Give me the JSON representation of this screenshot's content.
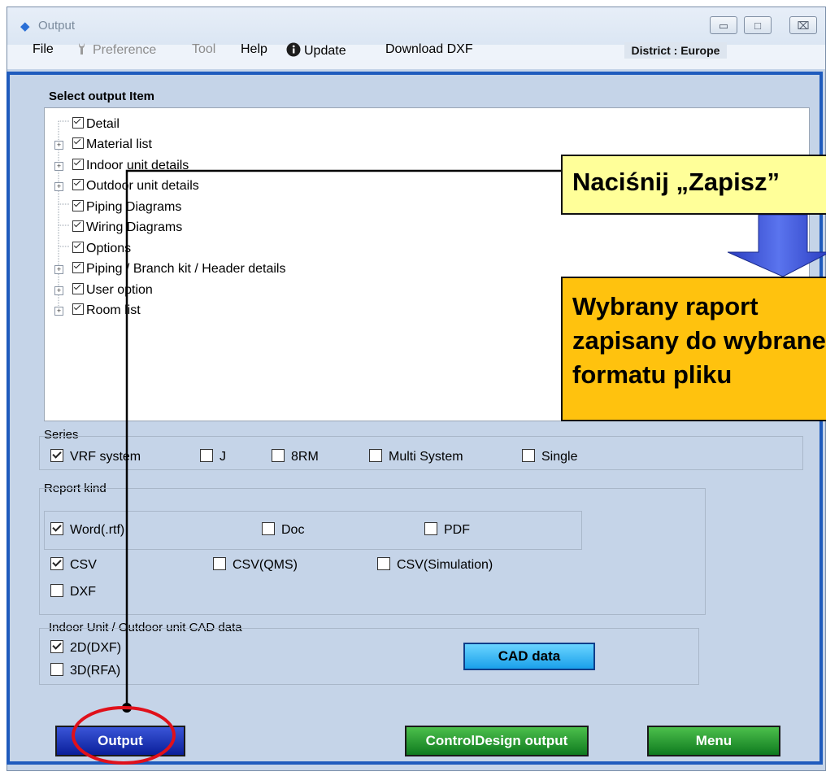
{
  "window": {
    "title": "Output",
    "minimize_glyph": "▭",
    "maximize_glyph": "□",
    "close_glyph": "⌧"
  },
  "menu": {
    "file": "File",
    "preference": "Preference",
    "tool": "Tool",
    "help": "Help",
    "update": "Update",
    "download_dxf": "Download DXF",
    "district": "District : Europe"
  },
  "select_output": {
    "label": "Select output Item",
    "items": [
      {
        "label": "Detail",
        "expandable": false,
        "checked": true
      },
      {
        "label": "Material list",
        "expandable": true,
        "checked": true
      },
      {
        "label": "Indoor unit details",
        "expandable": true,
        "checked": true
      },
      {
        "label": "Outdoor unit details",
        "expandable": true,
        "checked": true
      },
      {
        "label": "Piping Diagrams",
        "expandable": false,
        "checked": true
      },
      {
        "label": "Wiring Diagrams",
        "expandable": false,
        "checked": true
      },
      {
        "label": "Options",
        "expandable": false,
        "checked": true
      },
      {
        "label": "Piping / Branch kit / Header details",
        "expandable": true,
        "checked": true
      },
      {
        "label": "User option",
        "expandable": true,
        "checked": true
      },
      {
        "label": "Room list",
        "expandable": true,
        "checked": true
      }
    ]
  },
  "series": {
    "label": "Series",
    "options": [
      {
        "label": "VRF system",
        "checked": true
      },
      {
        "label": "J",
        "checked": false
      },
      {
        "label": "8RM",
        "checked": false
      },
      {
        "label": "Multi System",
        "checked": false
      },
      {
        "label": "Single",
        "checked": false
      }
    ]
  },
  "report_kind": {
    "label": "Report kind",
    "word": {
      "label": "Word(.rtf)",
      "checked": true
    },
    "doc": {
      "label": "Doc",
      "checked": false
    },
    "pdf": {
      "label": "PDF",
      "checked": false
    },
    "csv": {
      "label": "CSV",
      "checked": true
    },
    "csv_qms": {
      "label": "CSV(QMS)",
      "checked": false
    },
    "csv_sim": {
      "label": "CSV(Simulation)",
      "checked": false
    },
    "dxf": {
      "label": "DXF",
      "checked": false
    }
  },
  "cad": {
    "label": "Indoor Unit / Outdoor unit CAD data",
    "dxf2d": {
      "label": "2D(DXF)",
      "checked": true
    },
    "rfa3d": {
      "label": "3D(RFA)",
      "checked": false
    },
    "button": "CAD data"
  },
  "buttons": {
    "output": "Output",
    "control_design": "ControlDesign output",
    "menu": "Menu"
  },
  "annotations": {
    "callout1": "Naciśnij „Zapisz”",
    "callout2_line1": "Wybrany raport",
    "callout2_line2": "zapisany do wybranego",
    "callout2_line3": "formatu pliku"
  },
  "colors": {
    "frame": "#1f5bbd",
    "callout1_bg": "#ffff99",
    "callout2_bg": "#ffc20e",
    "circle": "#e0101a",
    "arrow": "#3a4fd0"
  }
}
